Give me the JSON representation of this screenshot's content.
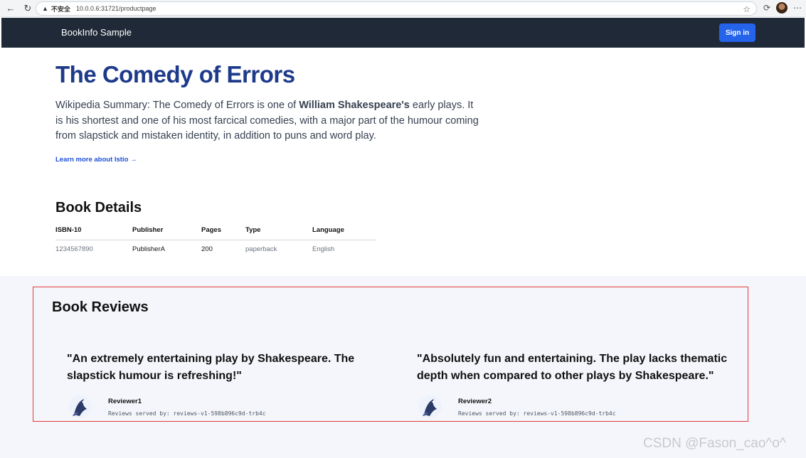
{
  "browser": {
    "insecure_label": "不安全",
    "url": "10.0.0.6:31721/productpage"
  },
  "header": {
    "title": "BookInfo Sample",
    "signin_label": "Sign in"
  },
  "product": {
    "title": "The Comedy of Errors",
    "summary_prefix": "Wikipedia Summary: The Comedy of Errors is one of ",
    "summary_bold": "William Shakespeare's",
    "summary_suffix": " early plays. It is his shortest and one of his most farcical comedies, with a major part of the humour coming from slapstick and mistaken identity, in addition to puns and word play.",
    "learn_more": "Learn more about Istio →"
  },
  "details": {
    "title": "Book Details",
    "columns": [
      "ISBN-10",
      "Publisher",
      "Pages",
      "Type",
      "Language"
    ],
    "row": [
      "1234567890",
      "PublisherA",
      "200",
      "paperback",
      "English"
    ]
  },
  "reviews": {
    "title": "Book Reviews",
    "items": [
      {
        "quote": "\"An extremely entertaining play by Shakespeare. The slapstick humour is refreshing!\"",
        "reviewer": "Reviewer1",
        "served_by": "Reviews served by: reviews-v1-598b896c9d-trb4c"
      },
      {
        "quote": "\"Absolutely fun and entertaining. The play lacks thematic depth when compared to other plays by Shakespeare.\"",
        "reviewer": "Reviewer2",
        "served_by": "Reviews served by: reviews-v1-598b896c9d-trb4c"
      }
    ]
  },
  "watermark": "CSDN @Fason_cao^o^",
  "colors": {
    "header_bg": "#1f2937",
    "signin_bg": "#2563eb",
    "title_color": "#1e3a8a",
    "review_border": "#e53935"
  },
  "icons": [
    "back-icon",
    "reload-icon",
    "warning-icon",
    "star-icon",
    "extension-icon",
    "profile-avatar",
    "more-icon",
    "istio-logo-icon"
  ]
}
